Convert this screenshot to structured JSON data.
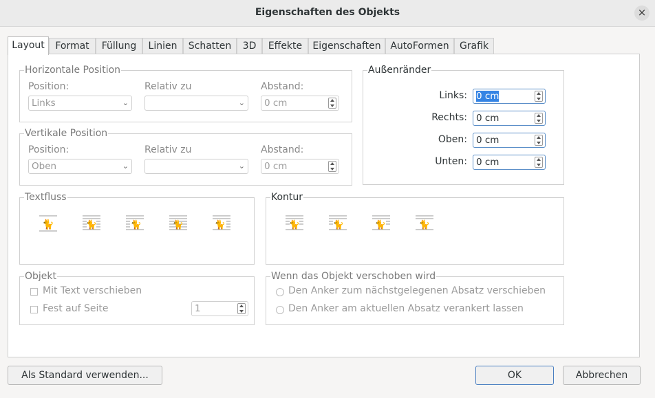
{
  "window": {
    "title": "Eigenschaften des Objekts"
  },
  "tabs": [
    "Layout",
    "Format",
    "Füllung",
    "Linien",
    "Schatten",
    "3D",
    "Effekte",
    "Eigenschaften",
    "AutoFormen",
    "Grafik"
  ],
  "horizontal": {
    "title": "Horizontale Position",
    "position_label": "Position:",
    "position_value": "Links",
    "relativ_label": "Relativ zu",
    "relativ_value": "",
    "abstand_label": "Abstand:",
    "abstand_value": "0 cm"
  },
  "vertical": {
    "title": "Vertikale Position",
    "position_label": "Position:",
    "position_value": "Oben",
    "relativ_label": "Relativ zu",
    "relativ_value": "",
    "abstand_label": "Abstand:",
    "abstand_value": "0 cm"
  },
  "margins": {
    "title": "Außenränder",
    "links_label": "Links:",
    "links_value": "0 cm",
    "rechts_label": "Rechts:",
    "rechts_value": "0 cm",
    "oben_label": "Oben:",
    "oben_value": "0 cm",
    "unten_label": "Unten:",
    "unten_value": "0 cm"
  },
  "textfluss": {
    "title": "Textfluss"
  },
  "kontur": {
    "title": "Kontur"
  },
  "objekt": {
    "title": "Objekt",
    "mit_text": "Mit Text verschieben",
    "fest_auf_seite": "Fest auf Seite",
    "page_value": "1"
  },
  "verschoben": {
    "title": "Wenn das Objekt verschoben wird",
    "option1": "Den Anker zum nächstgelegenen Absatz verschieben",
    "option2": "Den Anker am aktuellen Absatz verankert lassen"
  },
  "buttons": {
    "standard": "Als Standard verwenden...",
    "ok": "OK",
    "cancel": "Abbrechen"
  },
  "colors": {
    "accent": "#3584e4",
    "disabled_text": "#9a9a9a"
  }
}
